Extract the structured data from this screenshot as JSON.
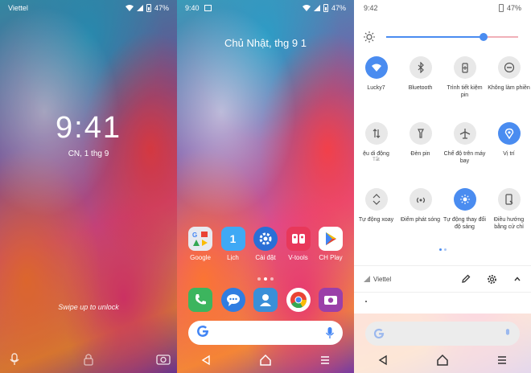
{
  "lock": {
    "carrier": "Viettel",
    "battery": "47%",
    "time": "9:41",
    "date": "CN, 1 thg 9",
    "hint": "Swipe up to unlock",
    "bottom_icons": [
      "microphone-icon",
      "lock-icon",
      "camera-icon"
    ]
  },
  "home": {
    "time": "9:40",
    "battery": "47%",
    "date": "Chủ Nhật, thg 9 1",
    "apps_row1": [
      {
        "label": "Google",
        "icon": "google-folder-icon",
        "color": "#e8eaf0"
      },
      {
        "label": "Lịch",
        "icon": "calendar-icon",
        "color": "#3fa9f5",
        "glyph": "1"
      },
      {
        "label": "Cài đặt",
        "icon": "settings-icon",
        "color": "#2a6fd6"
      },
      {
        "label": "V-tools",
        "icon": "vtools-icon",
        "color": "#e8385a"
      },
      {
        "label": "CH Play",
        "icon": "play-store-icon",
        "color": "#ffffff"
      }
    ],
    "dock": [
      {
        "icon": "phone-icon",
        "color": "#3cb55e"
      },
      {
        "icon": "messages-icon",
        "color": "#2f7de1"
      },
      {
        "icon": "contacts-icon",
        "color": "#3a8fd8"
      },
      {
        "icon": "chrome-icon",
        "color": "#ffffff"
      },
      {
        "icon": "camera-app-icon",
        "color": "#9b3fa8"
      }
    ],
    "page_dots": 3,
    "active_dot": 1
  },
  "quick_settings": {
    "time": "9:42",
    "battery": "47%",
    "brightness_fraction": 0.74,
    "tiles": [
      {
        "label": "Lucky7",
        "icon": "wifi-icon",
        "active": true
      },
      {
        "label": "Bluetooth",
        "icon": "bluetooth-icon",
        "active": false
      },
      {
        "label": "Trình tiết kiệm pin",
        "icon": "battery-saver-icon",
        "active": false
      },
      {
        "label": "Không làm phiền",
        "icon": "do-not-disturb-icon",
        "active": false
      },
      {
        "label": "ệu di động",
        "sub": "Tắt",
        "icon": "mobile-data-icon",
        "active": false
      },
      {
        "label": "Đèn pin",
        "icon": "flashlight-icon",
        "active": false
      },
      {
        "label": "Chế độ trên máy bay",
        "icon": "airplane-icon",
        "active": false
      },
      {
        "label": "Vị trí",
        "icon": "location-icon",
        "active": true
      },
      {
        "label": "Tự động xoay",
        "icon": "auto-rotate-icon",
        "active": false
      },
      {
        "label": "Điểm phát sóng",
        "icon": "hotspot-icon",
        "active": false
      },
      {
        "label": "Tự động thay đổi độ sáng",
        "icon": "auto-brightness-icon",
        "active": true
      },
      {
        "label": "Điều hướng bằng cử chỉ",
        "icon": "gesture-nav-icon",
        "active": false
      }
    ],
    "carrier": "Viettel",
    "colors": {
      "accent": "#4a8cf0",
      "tile_off": "#e8e8e8"
    }
  }
}
